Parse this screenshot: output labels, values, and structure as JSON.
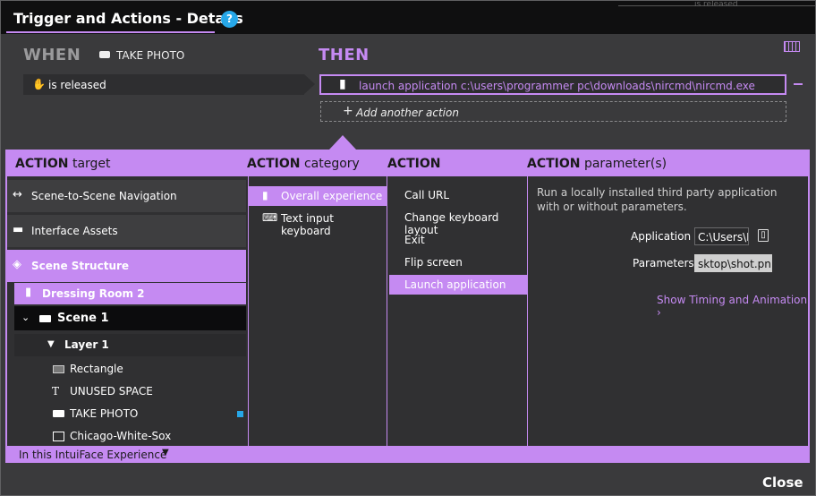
{
  "window": {
    "title": "Trigger and Actions - Details",
    "help_label": "?",
    "close_label": "Close"
  },
  "top_right": {
    "partial_text": "is released"
  },
  "trigger": {
    "heading": "WHEN",
    "source_label": "TAKE PHOTO",
    "source_icon": "button-icon",
    "event_label": "is released",
    "event_icon": "hand-icon"
  },
  "actions": {
    "heading": "THEN",
    "items": [
      {
        "label": "launch application c:\\users\\programmer pc\\downloads\\nircmd\\nircmd.exe",
        "icon": "experience-icon"
      }
    ],
    "add_label": "Add another action",
    "add_icon": "plus-icon"
  },
  "panel": {
    "headers": [
      {
        "bold": "ACTION",
        "rest": "target"
      },
      {
        "bold": "ACTION",
        "rest": "category"
      },
      {
        "bold": "ACTION",
        "rest": ""
      },
      {
        "bold": "ACTION",
        "rest": "parameter(s)"
      }
    ],
    "targets": [
      {
        "label": "Scene-to-Scene Navigation",
        "icon": "navigation-arrows-icon"
      },
      {
        "label": "Interface Assets",
        "icon": "assets-icon"
      },
      {
        "label": "Scene Structure",
        "icon": "layers-icon",
        "selected": true
      }
    ],
    "tree": {
      "experience": "Dressing Room 2",
      "scene": "Scene 1",
      "layer": "Layer 1",
      "items": [
        {
          "label": "Rectangle",
          "icon": "rectangle-icon"
        },
        {
          "label": "UNUSED SPACE",
          "icon": "text-icon"
        },
        {
          "label": "TAKE PHOTO",
          "icon": "button-icon",
          "marked": true
        },
        {
          "label": "Chicago-White-Sox",
          "icon": "image-icon"
        }
      ]
    },
    "categories": [
      {
        "label": "Overall experience",
        "icon": "experience-icon",
        "selected": true
      },
      {
        "label": "Text input keyboard",
        "icon": "keyboard-icon"
      }
    ],
    "actions_list": [
      {
        "label": "Call URL"
      },
      {
        "label": "Change keyboard layout"
      },
      {
        "label": "Exit"
      },
      {
        "label": "Flip screen"
      },
      {
        "label": "Launch application",
        "selected": true
      }
    ],
    "parameters": {
      "description": "Run a locally installed third party application with or without parameters.",
      "application_label": "Application",
      "application_value": "C:\\Users\\P",
      "parameters_label": "Parameters",
      "parameters_value": "sktop\\shot.png\"",
      "timing_link": "Show Timing and Animation"
    },
    "footer_scope": "In this IntuiFace Experience"
  },
  "colors": {
    "accent": "#c58af2",
    "help": "#27a7e8",
    "background": "#3a3a3c",
    "titlebar": "#0f0f10"
  }
}
